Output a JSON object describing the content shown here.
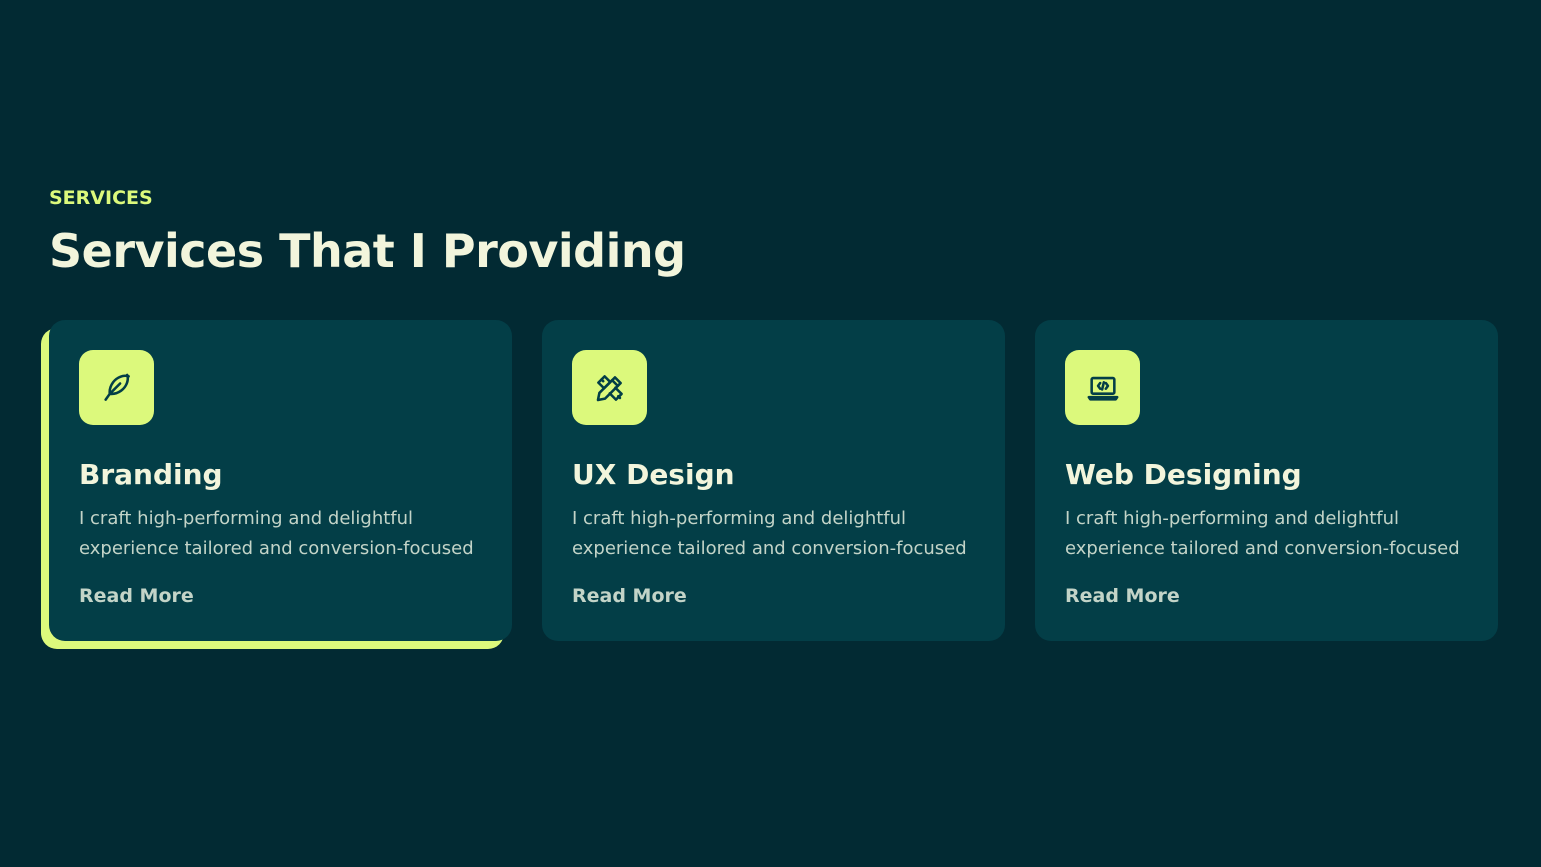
{
  "section": {
    "eyebrow": "SERVICES",
    "heading": "Services That I Providing"
  },
  "colors": {
    "background": "#022a33",
    "card": "#033e47",
    "accent": "#dcf97c",
    "heading": "#f2f5dc",
    "body_text": "#c3d4c8"
  },
  "services": [
    {
      "icon": "feather-icon",
      "title": "Branding",
      "description": "I craft high-performing and delightful experience tailored and conversion-focused",
      "link": "Read More",
      "active": true
    },
    {
      "icon": "pencil-ruler-icon",
      "title": "UX Design",
      "description": "I craft high-performing and delightful experience tailored and conversion-focused",
      "link": "Read More",
      "active": false
    },
    {
      "icon": "laptop-code-icon",
      "title": "Web Designing",
      "description": "I craft high-performing and delightful experience tailored and conversion-focused",
      "link": "Read More",
      "active": false
    }
  ]
}
